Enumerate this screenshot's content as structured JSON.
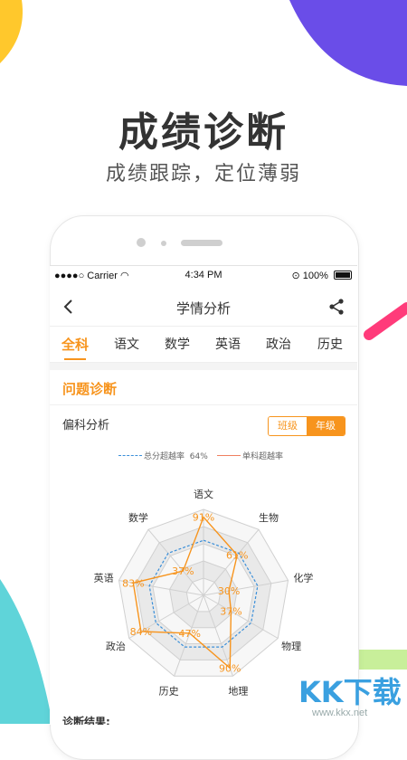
{
  "hero": {
    "title": "成绩诊断",
    "subtitle": "成绩跟踪，定位薄弱"
  },
  "status_bar": {
    "carrier": "Carrier",
    "time": "4:34 PM",
    "battery": "100%"
  },
  "nav": {
    "title": "学情分析"
  },
  "tabs": [
    "全科",
    "语文",
    "数学",
    "英语",
    "政治",
    "历史"
  ],
  "active_tab": "全科",
  "section": {
    "title": "问题诊断",
    "subtitle": "偏科分析",
    "toggle": {
      "class_label": "班级",
      "grade_label": "年级",
      "selected": "年级"
    }
  },
  "legend": {
    "total_label": "总分超越率",
    "total_value": "64%",
    "single_label": "单科超越率"
  },
  "diagnosis_label": "诊断结果:",
  "watermark": {
    "brand": "KK下载",
    "url": "www.kkx.net"
  },
  "colors": {
    "accent": "#f7941d",
    "total_line": "#3a8fd9",
    "single_line": "#f08060"
  },
  "chart_data": {
    "type": "radar",
    "title": "偏科分析",
    "axes": [
      "语文",
      "生物",
      "化学",
      "物理",
      "地理",
      "历史",
      "政治",
      "英语",
      "数学"
    ],
    "series": [
      {
        "name": "单科超越率",
        "values": [
          91,
          61,
          30,
          37,
          90,
          null,
          84,
          83,
          37
        ]
      },
      {
        "name": "总分超越率",
        "values": [
          64,
          64,
          64,
          64,
          64,
          64,
          64,
          64,
          64
        ]
      }
    ],
    "labels_shown": [
      {
        "axis": "语文",
        "text": "91%"
      },
      {
        "axis": "生物",
        "text": "61%"
      },
      {
        "axis": "化学",
        "text": "30%"
      },
      {
        "axis": "物理",
        "text": "37%"
      },
      {
        "axis": "地理",
        "text": "90%"
      },
      {
        "axis": "历史",
        "text": "47%"
      },
      {
        "axis": "政治",
        "text": "84%"
      },
      {
        "axis": "英语",
        "text": "83%"
      },
      {
        "axis": "数学",
        "text": "37%"
      }
    ],
    "range": [
      0,
      100
    ],
    "grid_levels": 5
  }
}
